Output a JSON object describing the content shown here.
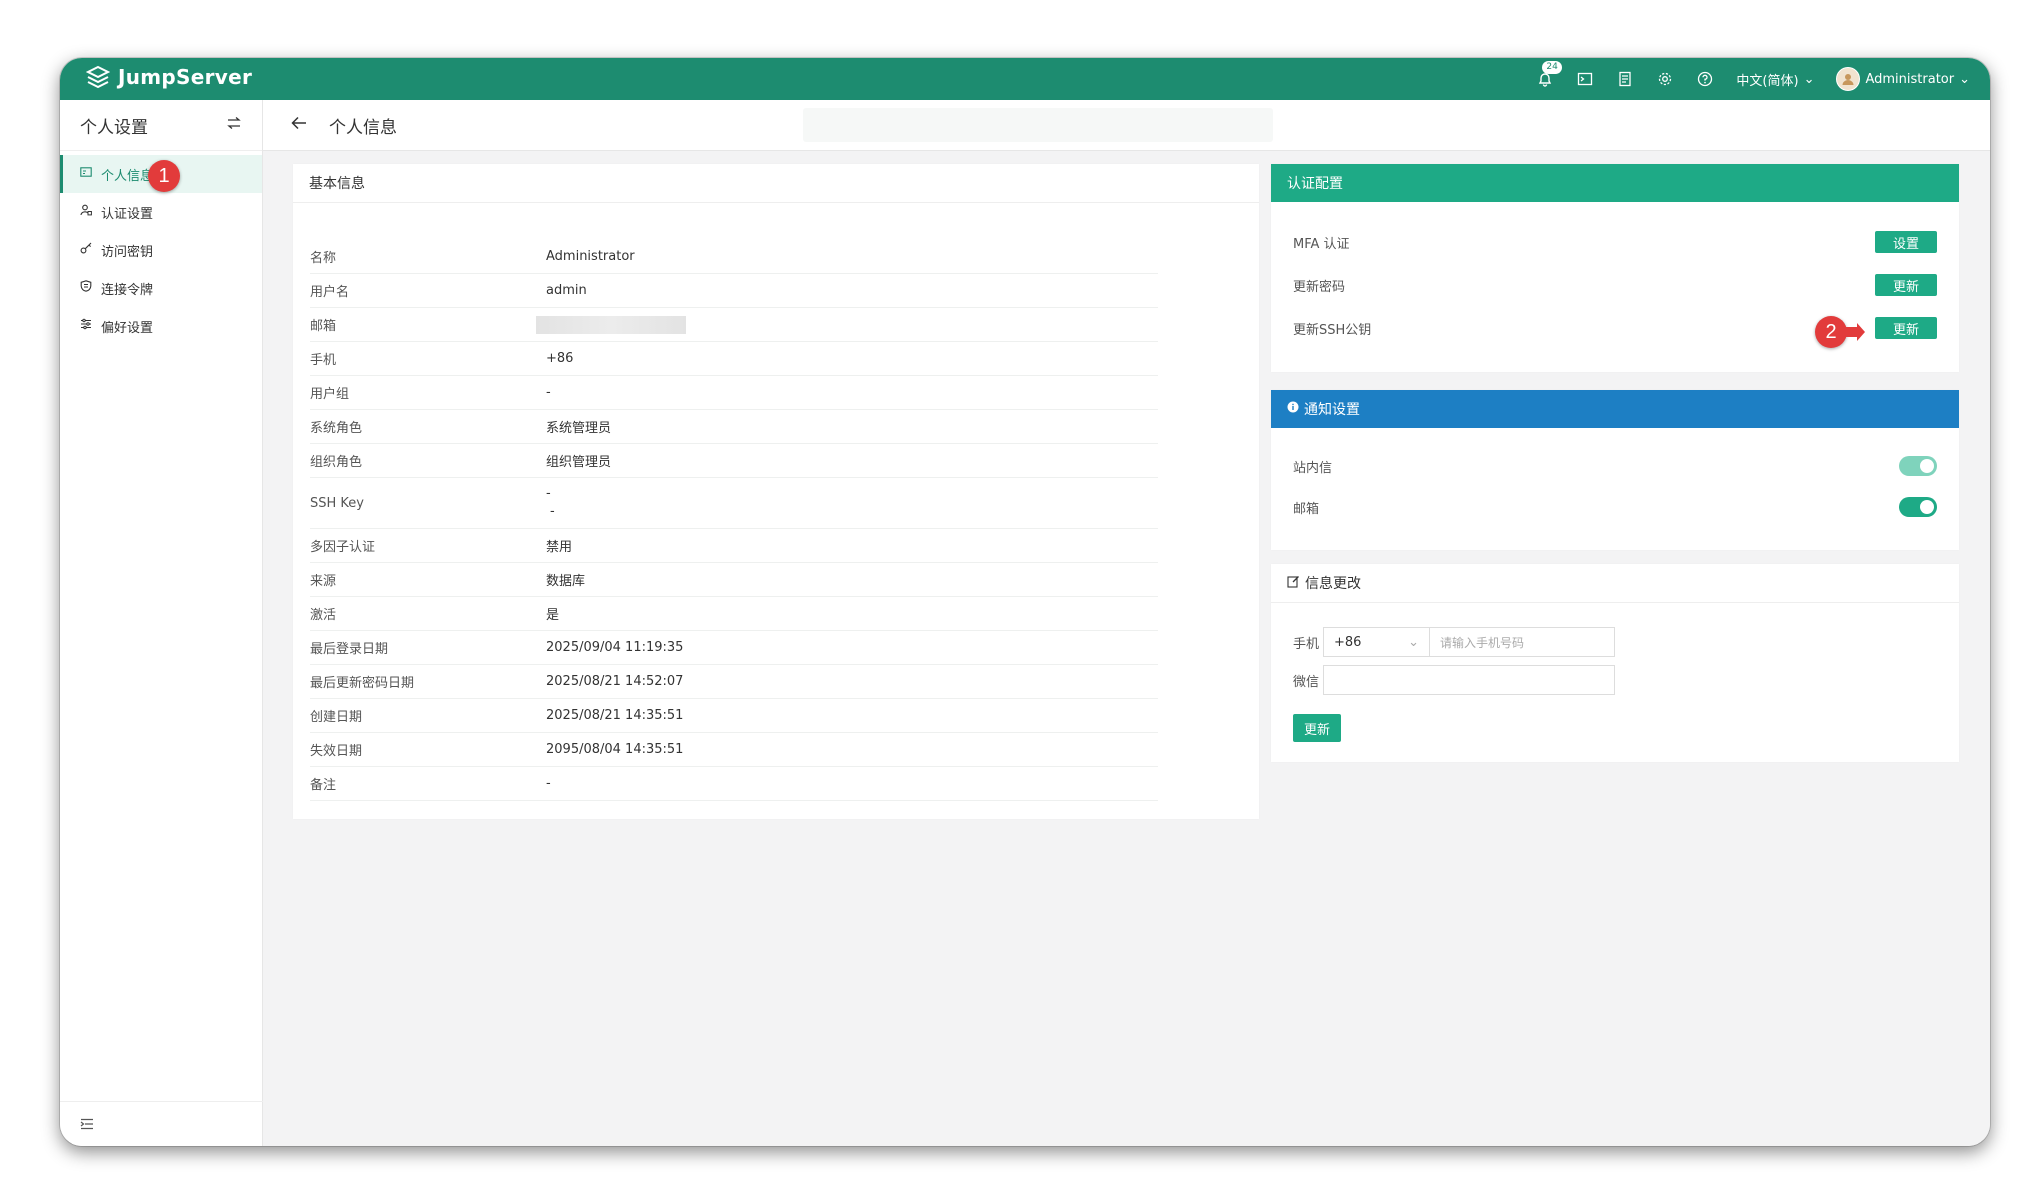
{
  "app": {
    "name": "JumpServer"
  },
  "topbar": {
    "notifications_count": "24",
    "language": "中文(简体)",
    "user": "Administrator"
  },
  "sidebar": {
    "title": "个人设置",
    "items": [
      {
        "label": "个人信息",
        "icon": "profile-card-icon",
        "active": true
      },
      {
        "label": "认证设置",
        "icon": "user-lock-icon"
      },
      {
        "label": "访问密钥",
        "icon": "key-icon"
      },
      {
        "label": "连接令牌",
        "icon": "shield-icon"
      },
      {
        "label": "偏好设置",
        "icon": "sliders-icon"
      }
    ]
  },
  "page": {
    "title": "个人信息"
  },
  "basic_info": {
    "title": "基本信息",
    "rows": [
      {
        "key": "名称",
        "value": "Administrator"
      },
      {
        "key": "用户名",
        "value": "admin"
      },
      {
        "key": "邮箱",
        "value": ""
      },
      {
        "key": "手机",
        "value": "+86"
      },
      {
        "key": "用户组",
        "value": "-"
      },
      {
        "key": "系统角色",
        "value": "系统管理员"
      },
      {
        "key": "组织角色",
        "value": "组织管理员"
      },
      {
        "key": "SSH Key",
        "value": "-",
        "value2": "-"
      },
      {
        "key": "多因子认证",
        "value": "禁用"
      },
      {
        "key": "来源",
        "value": "数据库"
      },
      {
        "key": "激活",
        "value": "是"
      },
      {
        "key": "最后登录日期",
        "value": "2025/09/04 11:19:35"
      },
      {
        "key": "最后更新密码日期",
        "value": "2025/08/21 14:52:07"
      },
      {
        "key": "创建日期",
        "value": "2025/08/21 14:35:51"
      },
      {
        "key": "失效日期",
        "value": "2095/08/04 14:35:51"
      },
      {
        "key": "备注",
        "value": "-"
      }
    ]
  },
  "auth_config": {
    "title": "认证配置",
    "rows": [
      {
        "label": "MFA 认证",
        "button": "设置"
      },
      {
        "label": "更新密码",
        "button": "更新"
      },
      {
        "label": "更新SSH公钥",
        "button": "更新"
      }
    ]
  },
  "notify": {
    "title": "通知设置",
    "rows": [
      {
        "label": "站内信",
        "enabled": true
      },
      {
        "label": "邮箱",
        "enabled": true
      }
    ]
  },
  "info_change": {
    "title": "信息更改",
    "phone_label": "手机",
    "phone_code": "+86",
    "phone_placeholder": "请输入手机号码",
    "wechat_label": "微信",
    "wechat_value": "",
    "submit": "更新"
  },
  "markers": {
    "m1": "1",
    "m2": "2"
  },
  "colors": {
    "brand": "#1d8c70",
    "accent": "#1eaa86",
    "info": "#1d7fc4",
    "marker": "#e23b3b"
  }
}
